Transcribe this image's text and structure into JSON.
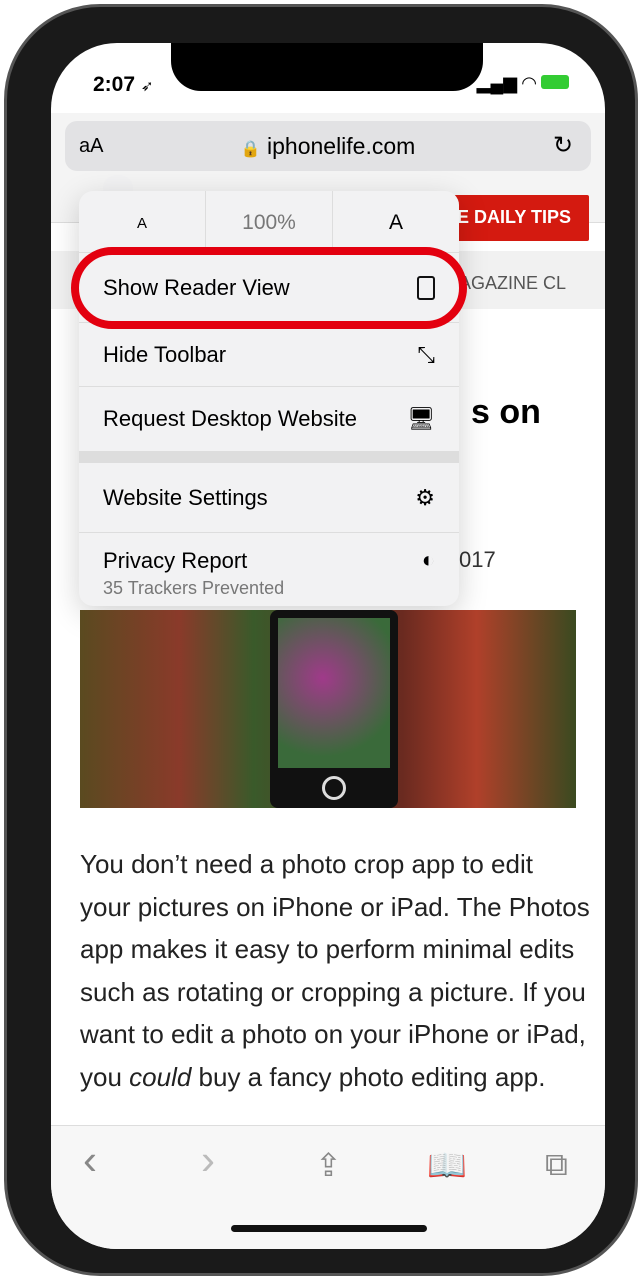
{
  "status": {
    "time": "2:07",
    "location_icon": "➶",
    "signal": "▂▄▆",
    "wifi": "wifi-icon",
    "battery": "charging"
  },
  "urlbar": {
    "aa": "aA",
    "lock": "🔒",
    "url": "iphonelife.com",
    "reload": "↻"
  },
  "site": {
    "banner": "E DAILY TIPS",
    "nav": "AGAZINE  CL",
    "title_fragment": "s on",
    "date_fragment": "017"
  },
  "menu": {
    "zoom": {
      "smaller": "A",
      "level": "100%",
      "larger": "A"
    },
    "items": [
      {
        "label": "Show Reader View",
        "icon": "reader-icon"
      },
      {
        "label": "Hide Toolbar",
        "icon": "expand-arrows-icon"
      },
      {
        "label": "Request Desktop Website",
        "icon": "desktop-icon"
      },
      {
        "label": "Website Settings",
        "icon": "gear-icon"
      },
      {
        "label": "Privacy Report",
        "sub": "35 Trackers Prevented",
        "icon": "shield-icon"
      }
    ],
    "highlight_color": "#e3000f"
  },
  "article": {
    "text_before": "You don’t need a photo crop app to edit your pictures on iPhone or iPad. The Photos app makes it easy to perform minimal edits such as rotating or cropping a picture. If you want to edit a photo on your iPhone or iPad, you ",
    "italic": "could",
    "text_after": " buy a fancy photo editing app."
  },
  "toolbar": {
    "back": "‹",
    "forward": "›"
  }
}
